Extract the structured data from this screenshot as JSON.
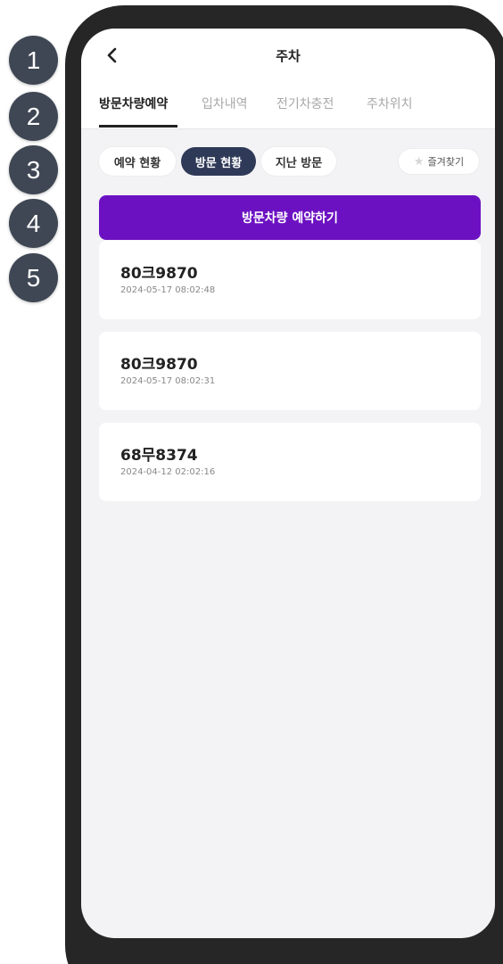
{
  "markers": [
    "1",
    "2",
    "3",
    "4",
    "5"
  ],
  "header": {
    "title": "주차",
    "back_icon": "chevron-left-icon"
  },
  "tabs": [
    {
      "label": "방문차량예약",
      "active": true
    },
    {
      "label": "입차내역",
      "active": false
    },
    {
      "label": "전기차충전",
      "active": false
    },
    {
      "label": "주차위치",
      "active": false
    }
  ],
  "filters": {
    "chips": [
      {
        "label": "예약 현황",
        "active": false
      },
      {
        "label": "방문 현황",
        "active": true
      },
      {
        "label": "지난 방문",
        "active": false
      }
    ],
    "favorites": {
      "label": "즐겨찾기",
      "icon": "star-icon"
    }
  },
  "actions": {
    "reserve_label": "방문차량 예약하기"
  },
  "visits": [
    {
      "plate": "80크9870",
      "datetime": "2024-05-17 08:02:48"
    },
    {
      "plate": "80크9870",
      "datetime": "2024-05-17 08:02:31"
    },
    {
      "plate": "68무8374",
      "datetime": "2024-04-12 02:02:16"
    }
  ],
  "colors": {
    "accent": "#6c11c2",
    "active_chip": "#2f3a58",
    "marker": "#3f4754",
    "frame": "#262626",
    "background": "#f3f3f5"
  }
}
